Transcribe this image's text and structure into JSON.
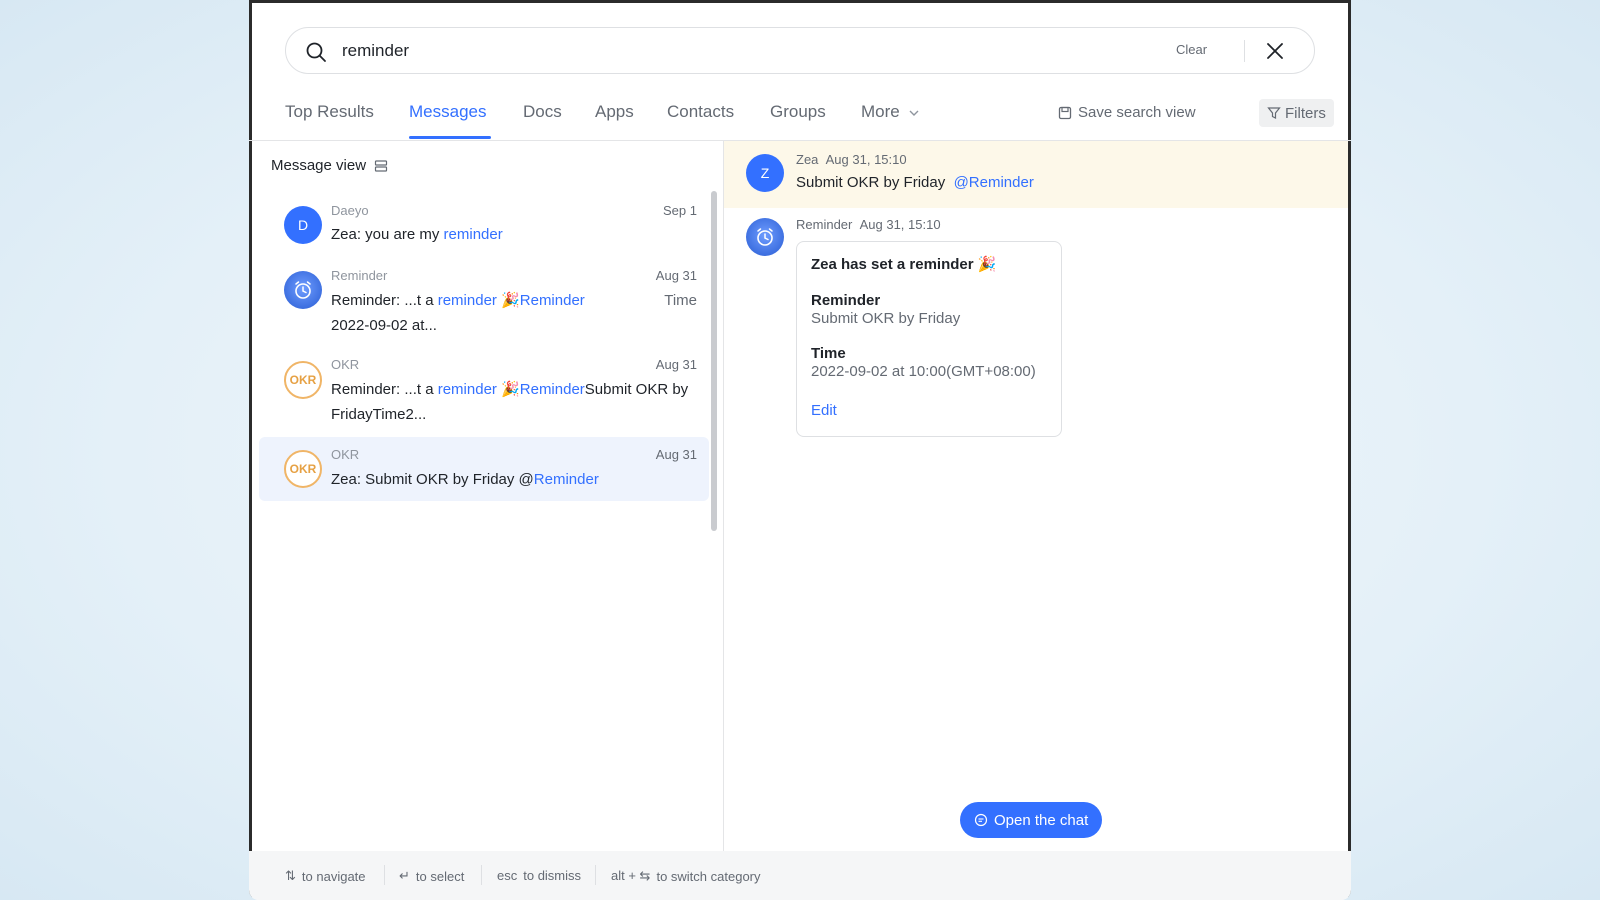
{
  "search": {
    "query": "reminder",
    "clear_label": "Clear"
  },
  "tabs": [
    {
      "label": "Top Results"
    },
    {
      "label": "Messages"
    },
    {
      "label": "Docs"
    },
    {
      "label": "Apps"
    },
    {
      "label": "Contacts"
    },
    {
      "label": "Groups"
    },
    {
      "label": "More"
    }
  ],
  "toolbar": {
    "save_view_label": "Save search view",
    "filters_label": "Filters"
  },
  "list": {
    "view_label": "Message view",
    "items": [
      {
        "avatar_letter": "D",
        "sender": "Daeyo",
        "date": "Sep 1",
        "text_prefix": "Zea: you are my ",
        "text_hl1": "reminder",
        "text_mid": "",
        "text_hl2": "",
        "text_suffix": ""
      },
      {
        "sender": "Reminder",
        "date": "Aug 31",
        "text_prefix": "Reminder: ...t a ",
        "text_hl1": "reminder",
        "text_mid": " 🎉",
        "text_hl2": "Reminder",
        "text_suffix": "2022-09-02 at...",
        "extra": "Time"
      },
      {
        "avatar_letter": "OKR",
        "sender": "OKR",
        "date": "Aug 31",
        "text_prefix": "Reminder: ...t a ",
        "text_hl1": "reminder",
        "text_mid": " 🎉",
        "text_hl2": "Reminder",
        "text_suffix": "Submit OKR by FridayTime2..."
      },
      {
        "avatar_letter": "OKR",
        "sender": "OKR",
        "date": "Aug 31",
        "text_prefix": "Zea: Submit OKR by Friday @",
        "text_hl1": "Reminder",
        "text_mid": "",
        "text_hl2": "",
        "text_suffix": ""
      }
    ]
  },
  "detail": {
    "msg1": {
      "avatar_letter": "Z",
      "sender": "Zea",
      "time": "Aug 31, 15:10",
      "text": "Submit OKR by Friday",
      "mention": "@Reminder"
    },
    "msg2": {
      "sender": "Reminder",
      "time": "Aug 31, 15:10"
    },
    "card": {
      "title": "Zea has set a reminder 🎉",
      "reminder_label": "Reminder",
      "reminder_value": "Submit OKR by Friday",
      "time_label": "Time",
      "time_value": "2022-09-02 at 10:00(GMT+08:00)",
      "edit_label": "Edit"
    },
    "open_chat_label": "Open the chat"
  },
  "footer": {
    "navigate_key": "⇅",
    "navigate_label": "to navigate",
    "select_key": "↵",
    "select_label": "to select",
    "dismiss_key": "esc",
    "dismiss_label": "to dismiss",
    "switch_key": "alt + ⇆",
    "switch_label": "to switch category"
  },
  "colors": {
    "accent": "#3370ff",
    "highlight_bg": "#fdf8e9",
    "selected_bg": "#eef3fd",
    "okr": "#e6a144"
  }
}
